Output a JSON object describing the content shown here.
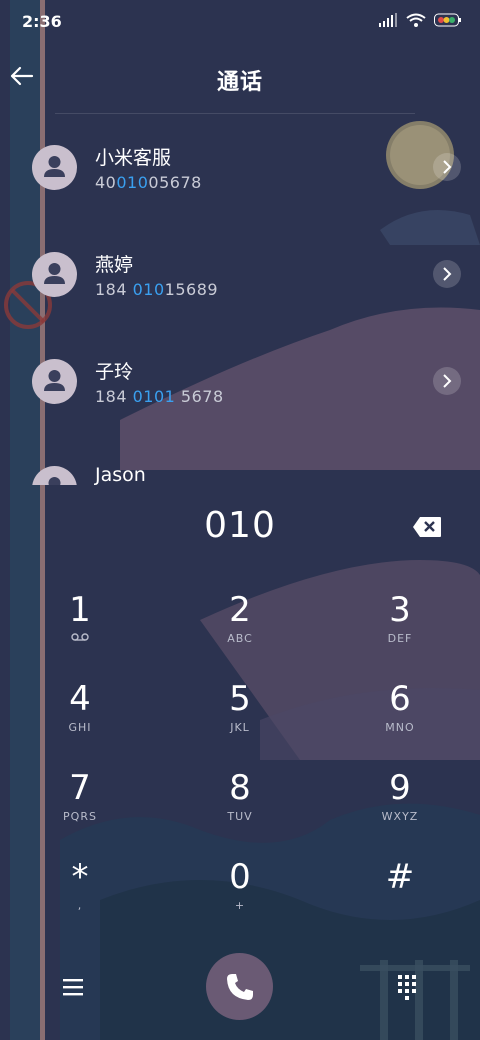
{
  "status_bar": {
    "time": "2:36"
  },
  "header": {
    "title": "通话"
  },
  "contacts": [
    {
      "name": "小米客服",
      "number_pre": "40",
      "number_hl": "010",
      "number_post": "05678"
    },
    {
      "name": "燕婷",
      "number_pre": "184 ",
      "number_hl": "010",
      "number_post": "15689"
    },
    {
      "name": "子玲",
      "number_pre": "184 ",
      "number_hl": "0101",
      "number_post": " 5678"
    },
    {
      "name": "Jason",
      "number_pre": "",
      "number_hl": "",
      "number_post": ""
    }
  ],
  "input": {
    "value": "010"
  },
  "keys": [
    {
      "digit": "1",
      "letters": ""
    },
    {
      "digit": "2",
      "letters": "ABC"
    },
    {
      "digit": "3",
      "letters": "DEF"
    },
    {
      "digit": "4",
      "letters": "GHI"
    },
    {
      "digit": "5",
      "letters": "JKL"
    },
    {
      "digit": "6",
      "letters": "MNO"
    },
    {
      "digit": "7",
      "letters": "PQRS"
    },
    {
      "digit": "8",
      "letters": "TUV"
    },
    {
      "digit": "9",
      "letters": "WXYZ"
    },
    {
      "digit": "*",
      "letters": ","
    },
    {
      "digit": "0",
      "letters": "+"
    },
    {
      "digit": "#",
      "letters": ""
    }
  ],
  "colors": {
    "highlight": "#3aa0f0",
    "background": "#2c3350",
    "call_button": "#6a5a74"
  }
}
